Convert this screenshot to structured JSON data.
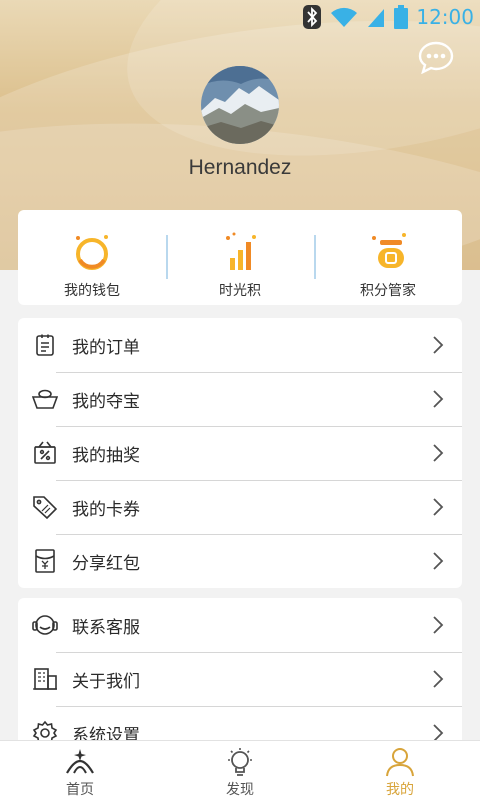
{
  "status": {
    "time": "12:00"
  },
  "profile": {
    "username": "Hernandez"
  },
  "quick_actions": [
    {
      "label": "我的钱包",
      "icon": "wallet-ring-icon"
    },
    {
      "label": "时光积",
      "icon": "bar-chart-icon"
    },
    {
      "label": "积分管家",
      "icon": "points-coin-icon"
    }
  ],
  "menu_main": [
    {
      "label": "我的订单",
      "icon": "clipboard-icon"
    },
    {
      "label": "我的夺宝",
      "icon": "treasure-icon"
    },
    {
      "label": "我的抽奖",
      "icon": "lottery-box-icon"
    },
    {
      "label": "我的卡券",
      "icon": "coupon-tag-icon"
    },
    {
      "label": "分享红包",
      "icon": "red-packet-icon"
    }
  ],
  "menu_other": [
    {
      "label": "联系客服",
      "icon": "headset-icon"
    },
    {
      "label": "关于我们",
      "icon": "building-icon"
    },
    {
      "label": "系统设置",
      "icon": "gear-icon"
    }
  ],
  "tabs": [
    {
      "label": "首页",
      "icon": "home-icon"
    },
    {
      "label": "发现",
      "icon": "lightbulb-icon"
    },
    {
      "label": "我的",
      "icon": "person-icon",
      "active": true
    }
  ],
  "colors": {
    "accent": "#d8a43a",
    "status_blue": "#39b1e6",
    "chart_orange": "#f08a25"
  }
}
